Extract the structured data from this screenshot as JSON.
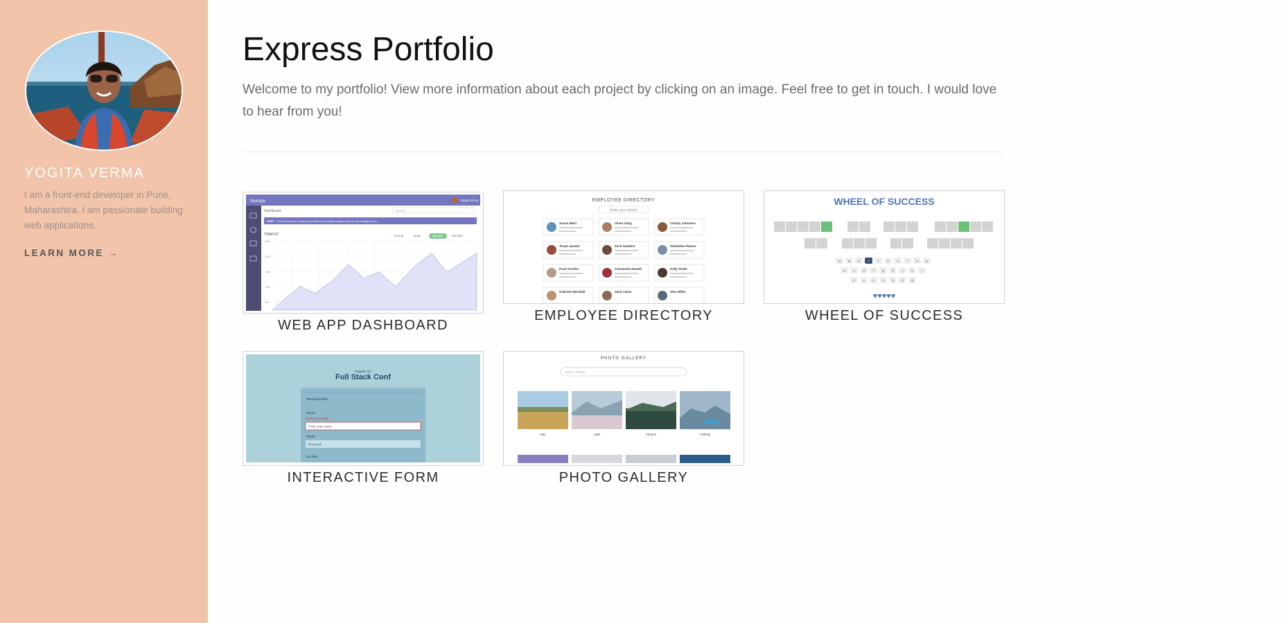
{
  "sidebar": {
    "avatar_icon": "profile-photo",
    "name": "YOGITA VERMA",
    "bio": "I am a front-end developer in Pune, Maharashtra. I am passionate building web applications.",
    "learn_more": "LEARN MORE →"
  },
  "main": {
    "title": "Express Portfolio",
    "intro": "Welcome to my portfolio! View more information about each project by clicking on an image. Feel free to get in touch. I would love to hear from you!"
  },
  "projects": [
    {
      "title": "WEB APP DASHBOARD",
      "preview": {
        "brand": "YourApp",
        "user": "Yogita Verma",
        "nav": "Dashboard",
        "search": "Search",
        "alert_label": "Alert",
        "alert_text": "Ut enim ad minim veniam quis nostrud exercitation ullamco laboris nisi ut aliquip ex ea",
        "chart_label": "TRAFFIC",
        "filters": [
          "Hourly",
          "Daily",
          "Weekly",
          "Monthly"
        ],
        "y_ticks": [
          "2500",
          "2000",
          "1500",
          "1000",
          "500",
          "0"
        ]
      }
    },
    {
      "title": "EMPLOYEE DIRECTORY",
      "preview": {
        "heading": "EMPLOYEE DIRECTORY",
        "search": "Enter your search",
        "people": [
          "Susan Mien",
          "Victor Garg",
          "Charity Johnston",
          "Tonya Jacobs",
          "Zach Sanders",
          "Sebastian Ramos",
          "Pearl Grinder",
          "Cassandra Howell",
          "Kelly Smith",
          "Gabriela Marshall",
          "Jack Carter",
          "Alex Miller"
        ]
      }
    },
    {
      "title": "WHEEL OF SUCCESS",
      "preview": {
        "heading": "WHEEL OF SUCCESS",
        "keys_row1": [
          "q",
          "w",
          "e",
          "r",
          "t",
          "y",
          "u",
          "i",
          "o",
          "p"
        ],
        "keys_row2": [
          "a",
          "s",
          "d",
          "f",
          "g",
          "h",
          "j",
          "k",
          "l"
        ],
        "keys_row3": [
          "z",
          "x",
          "c",
          "v",
          "b",
          "n",
          "m"
        ],
        "lives": "♥♥♥♥♥"
      }
    },
    {
      "title": "INTERACTIVE FORM",
      "preview": {
        "kicker": "Register for",
        "heading": "Full Stack Conf",
        "required_note": "*Required fields",
        "name_label": "*Name:",
        "name_error": "Enter your name",
        "name_placeholder": "Enter your name",
        "email_label": "*Email:",
        "email_placeholder": "Required",
        "job_label": "Job Role"
      }
    },
    {
      "title": "PHOTO GALLERY",
      "preview": {
        "heading": "PHOTO GALLERY",
        "search": "Search Photos",
        "captions": [
          "Hay",
          "Lake",
          "Canyon",
          "Iceberg"
        ]
      }
    }
  ],
  "colors": {
    "sidebar_bg": "#f2c4aa",
    "dashboard_purple": "#7477bf",
    "wheel_blue": "#4d75b3",
    "wheel_green": "#6ac178",
    "form_blue": "#acd1db"
  }
}
